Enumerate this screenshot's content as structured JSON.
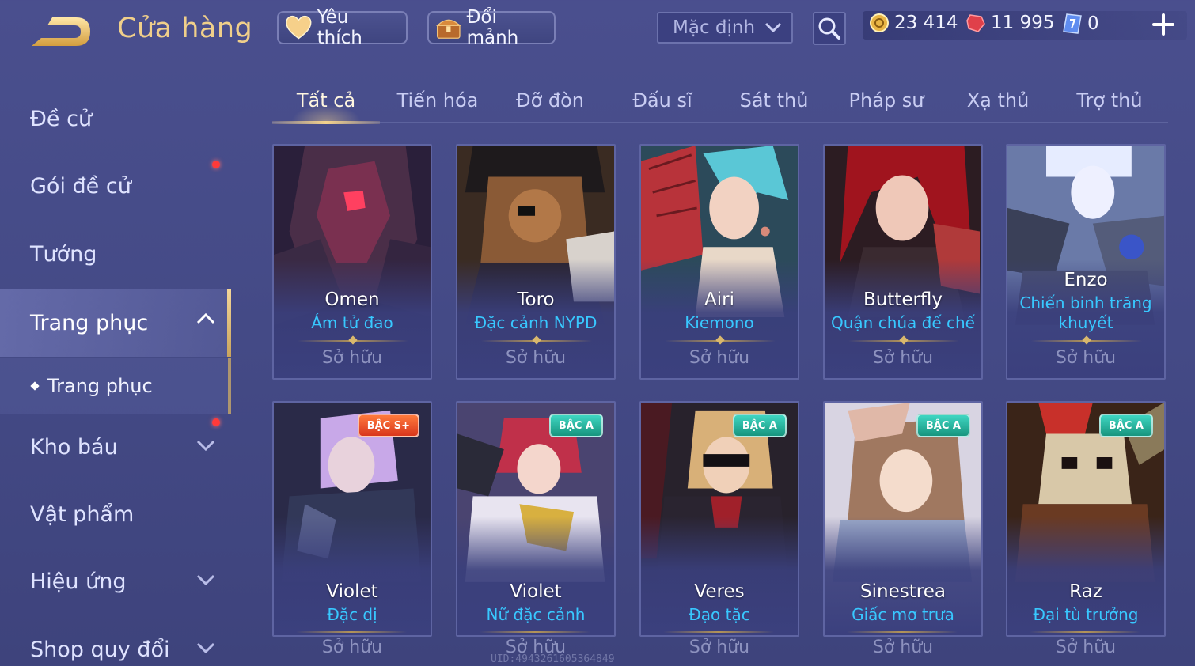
{
  "header": {
    "title": "Cửa hàng",
    "favorite_label": "Yêu thích",
    "exchange_label": "Đổi mảnh",
    "sort_value": "Mặc định"
  },
  "currencies": {
    "gold": "23 414",
    "gems": "11 995",
    "vouchers": "0"
  },
  "sidebar": {
    "items": [
      {
        "label": "Đề cử"
      },
      {
        "label": "Gói đề cử"
      },
      {
        "label": "Tướng"
      },
      {
        "label": "Trang phục"
      },
      {
        "label": "Kho báu"
      },
      {
        "label": "Vật phẩm"
      },
      {
        "label": "Hiệu ứng"
      },
      {
        "label": "Shop quy đổi"
      }
    ],
    "sub_item": "Trang phục"
  },
  "tabs": [
    {
      "label": "Tất cả"
    },
    {
      "label": "Tiến hóa"
    },
    {
      "label": "Đỡ đòn"
    },
    {
      "label": "Đấu sĩ"
    },
    {
      "label": "Sát thủ"
    },
    {
      "label": "Pháp sư"
    },
    {
      "label": "Xạ thủ"
    },
    {
      "label": "Trợ thủ"
    }
  ],
  "cards": [
    {
      "hero": "Omen",
      "skin": "Ám tử đao",
      "status": "Sở hữu"
    },
    {
      "hero": "Toro",
      "skin": "Đặc cảnh NYPD",
      "status": "Sở hữu"
    },
    {
      "hero": "Airi",
      "skin": "Kiemono",
      "status": "Sở hữu"
    },
    {
      "hero": "Butterfly",
      "skin": "Quận chúa đế chế",
      "status": "Sở hữu"
    },
    {
      "hero": "Enzo",
      "skin": "Chiến binh trăng khuyết",
      "status": "Sở hữu"
    },
    {
      "hero": "Violet",
      "skin": "Đặc dị",
      "status": "Sở hữu",
      "badge": "BẬC S+"
    },
    {
      "hero": "Violet",
      "skin": "Nữ đặc cảnh",
      "status": "Sở hữu",
      "badge": "BẬC A"
    },
    {
      "hero": "Veres",
      "skin": "Đạo tặc",
      "status": "Sở hữu",
      "badge": "BẬC A"
    },
    {
      "hero": "Sinestrea",
      "skin": "Giấc mơ trưa",
      "status": "Sở hữu",
      "badge": "BẬC A"
    },
    {
      "hero": "Raz",
      "skin": "Đại tù trưởng",
      "status": "Sở hữu",
      "badge": "BẬC A"
    }
  ],
  "footer": {
    "uid": "UID:4943261605364849"
  }
}
